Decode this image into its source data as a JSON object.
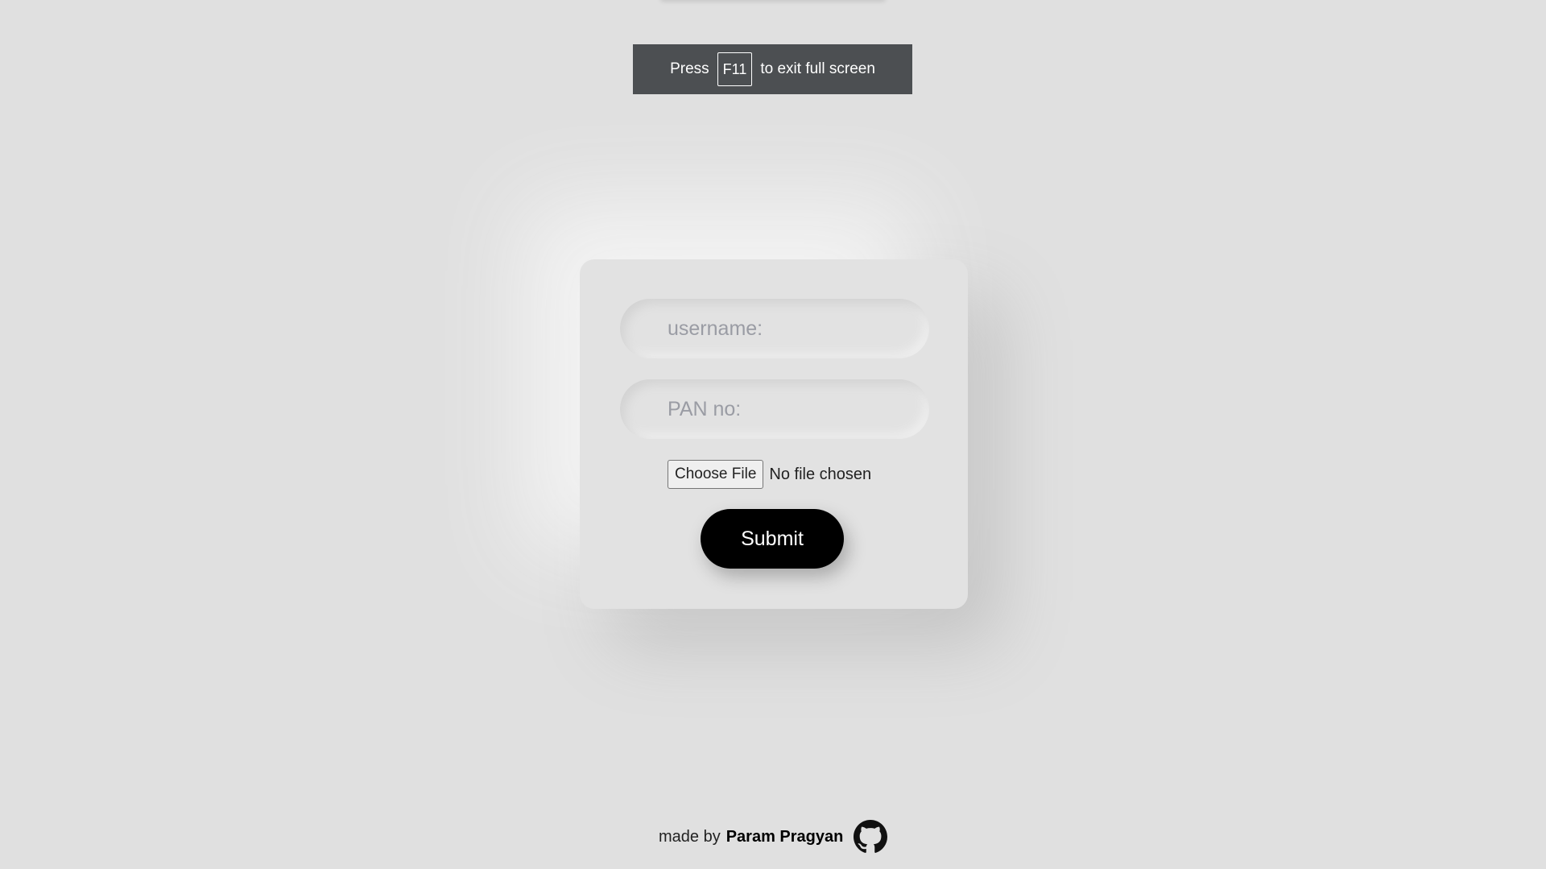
{
  "fullscreen_notice": {
    "prefix": "Press",
    "key": "F11",
    "suffix": "to exit full screen"
  },
  "form": {
    "username_placeholder": "username:",
    "pan_placeholder": "PAN no:",
    "choose_file_label": "Choose File",
    "file_status": "No file chosen",
    "submit_label": "Submit"
  },
  "footer": {
    "made_by_text": "made by",
    "author_name": "Param Pragyan",
    "icon": "github-icon"
  },
  "colors": {
    "background": "#e0e0e0",
    "notice_background": "#4c4f52",
    "submit_background": "#000000",
    "placeholder": "#9a9ca4"
  }
}
